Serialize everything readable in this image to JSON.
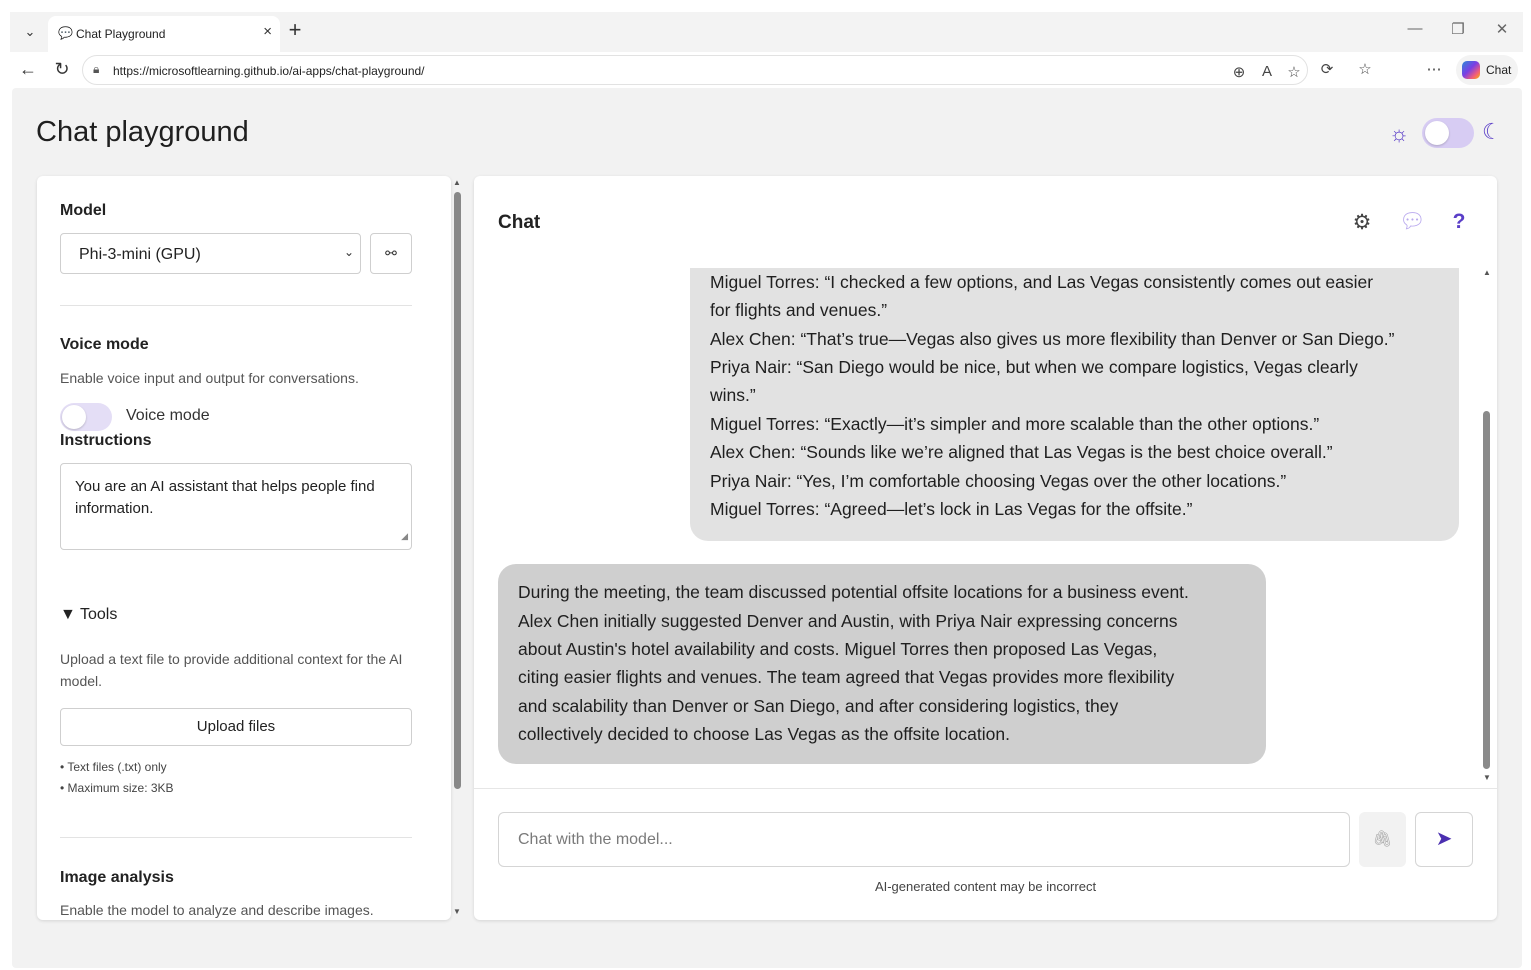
{
  "browser": {
    "tab_title": "Chat Playground",
    "tab_close": "×",
    "new_tab": "+",
    "url": "https://microsoftlearning.github.io/ai-apps/chat-playground/",
    "copilot_label": "Chat"
  },
  "page": {
    "title": "Chat playground"
  },
  "settings": {
    "model_label": "Model",
    "model_selected": "Phi-3-mini (GPU)",
    "voice_heading": "Voice mode",
    "voice_description": "Enable voice input and output for conversations.",
    "voice_toggle_label": "Voice mode",
    "instructions_label": "Instructions",
    "instructions_text": "You are an AI assistant that helps people find information.",
    "tools_heading": "▼ Tools",
    "tools_description": "Upload a text file to provide additional context for the AI model.",
    "upload_button": "Upload files",
    "note_1": "• Text files (.txt) only",
    "note_2": "• Maximum size: 3KB",
    "image_heading": "Image analysis",
    "image_description": "Enable the model to analyze and describe images."
  },
  "chat": {
    "title": "Chat",
    "user_message_lines": [
      "Miguel Torres: “I checked a few options, and Las Vegas consistently comes out easier",
      "for flights and venues.”",
      "Alex Chen: “That’s true—Vegas also gives us more flexibility than Denver or San Diego.”",
      "Priya Nair: “San Diego would be nice, but when we compare logistics, Vegas clearly",
      "wins.”",
      "Miguel Torres: “Exactly—it’s simpler and more scalable than the other options.”",
      "Alex Chen: “Sounds like we’re aligned that Las Vegas is the best choice overall.”",
      "Priya Nair: “Yes, I’m comfortable choosing Vegas over the other locations.”",
      "Miguel Torres: “Agreed—let’s lock in Las Vegas for the offsite.”"
    ],
    "ai_message_lines": [
      "During the meeting, the team discussed potential offsite locations for a business event.",
      "Alex Chen initially suggested Denver and Austin, with Priya Nair expressing concerns",
      "about Austin's hotel availability and costs. Miguel Torres then proposed Las Vegas,",
      "citing easier flights and venues. The team agreed that Vegas provides more flexibility",
      "and scalability than Denver or San Diego, and after considering logistics, they",
      "collectively decided to choose Las Vegas as the offsite location."
    ],
    "input_placeholder": "Chat with the model...",
    "disclaimer": "AI-generated content may be incorrect"
  },
  "colors": {
    "accent": "#5a3ec8",
    "user_bubble": "#e2e2e2",
    "ai_bubble": "#cfcfcf",
    "page_bg": "#f2f2f2"
  }
}
